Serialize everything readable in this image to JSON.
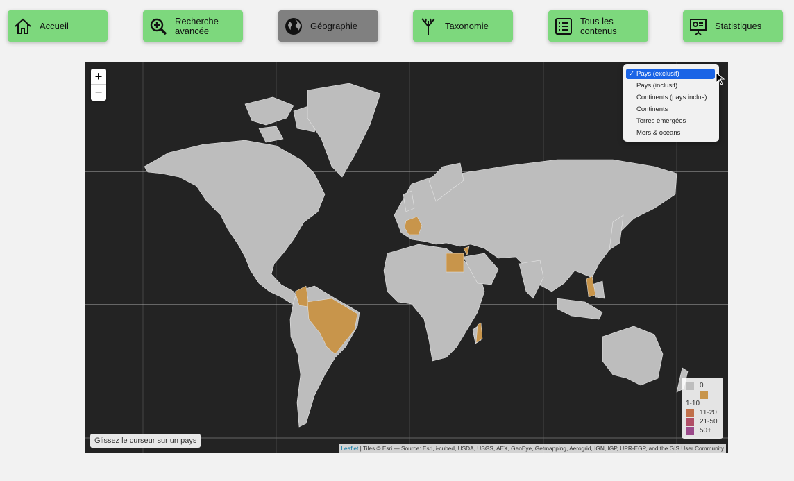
{
  "nav": {
    "items": [
      {
        "label": "Accueil",
        "icon": "home-icon",
        "active": false
      },
      {
        "label": "Recherche avancée",
        "icon": "magnifier-plus-icon",
        "active": false
      },
      {
        "label": "Géographie",
        "icon": "globe-icon",
        "active": true
      },
      {
        "label": "Taxonomie",
        "icon": "tree-branches-icon",
        "active": false
      },
      {
        "label": "Tous les contenus",
        "icon": "list-icon",
        "active": false
      },
      {
        "label": "Statistiques",
        "icon": "presentation-chart-icon",
        "active": false
      }
    ],
    "colors": {
      "button": "#7dd87d",
      "active": "#808080"
    }
  },
  "map": {
    "zoom_in": "+",
    "zoom_out": "−",
    "layer_options": [
      {
        "label": "Pays (exclusif)",
        "selected": true
      },
      {
        "label": "Pays (inclusif)",
        "selected": false
      },
      {
        "label": "Continents (pays inclus)",
        "selected": false
      },
      {
        "label": "Continents",
        "selected": false
      },
      {
        "label": "Terres émergées",
        "selected": false
      },
      {
        "label": "Mers & océans",
        "selected": false
      }
    ],
    "legend": [
      {
        "label": "0",
        "color": "#bdbdbd"
      },
      {
        "label": "1-10",
        "color": "#c8954b"
      },
      {
        "label": "11-20",
        "color": "#c0704a"
      },
      {
        "label": "21-50",
        "color": "#b04e66"
      },
      {
        "label": "50+",
        "color": "#9b4a8a"
      }
    ],
    "hover_hint": "Glissez le curseur sur un pays",
    "attribution_link": "Leaflet",
    "attribution_text": " | Tiles © Esri — Source: Esri, i-cubed, USDA, USGS, AEX, GeoEye, Getmapping, Aerogrid, IGN, IGP, UPR-EGP, and the GIS User Community",
    "colors": {
      "ocean": "#232323",
      "land": "#bdbdbd",
      "highlight": "#c8954b"
    }
  }
}
